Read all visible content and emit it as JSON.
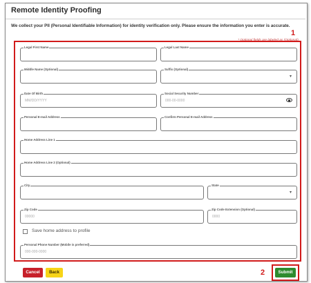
{
  "page": {
    "title": "Remote Identity Proofing",
    "intro": "We collect your PII (Personal Identifiable Information) for identity verification only. Please ensure the information you enter is accurate.",
    "optional_note": "* Optional fields are labeled as (Optional)."
  },
  "callouts": {
    "form_section": "1",
    "submit": "2"
  },
  "form": {
    "legal_first_name": {
      "label": "Legal First Name",
      "value": ""
    },
    "legal_last_name": {
      "label": "Legal Last Name",
      "value": ""
    },
    "middle_name": {
      "label": "Middle Name (Optional)",
      "value": ""
    },
    "suffix": {
      "label": "Suffix (Optional)",
      "value": ""
    },
    "date_of_birth": {
      "label": "Date Of Birth",
      "placeholder": "MM/DD/YYYY"
    },
    "ssn": {
      "label": "Social Security Number",
      "placeholder": "000-00-0000"
    },
    "email": {
      "label": "Personal E-mail Address",
      "value": ""
    },
    "confirm_email": {
      "label": "Confirm Personal E-mail Address",
      "value": ""
    },
    "address1": {
      "label": "Home Address Line 1",
      "value": ""
    },
    "address2": {
      "label": "Home Address Line 2 (Optional)",
      "value": ""
    },
    "city": {
      "label": "City",
      "value": ""
    },
    "state": {
      "label": "State",
      "value": ""
    },
    "zip": {
      "label": "Zip Code",
      "placeholder": "00000"
    },
    "zip_ext": {
      "label": "Zip Code Extension (Optional)",
      "placeholder": "0000"
    },
    "save_address": {
      "label": "Save home address to profile",
      "checked": false
    },
    "phone": {
      "label": "Personal Phone Number (Mobile is preferred)",
      "placeholder": "000-000-0000"
    }
  },
  "buttons": {
    "cancel": "Cancel",
    "back": "Back",
    "submit": "Submit"
  },
  "colors": {
    "callout_red": "#d11a1a",
    "cancel": "#c7202a",
    "back": "#f7d417",
    "submit": "#2e8b2e"
  },
  "icons": {
    "select": "chevron-down-icon",
    "ssn_toggle": "eye-icon"
  }
}
